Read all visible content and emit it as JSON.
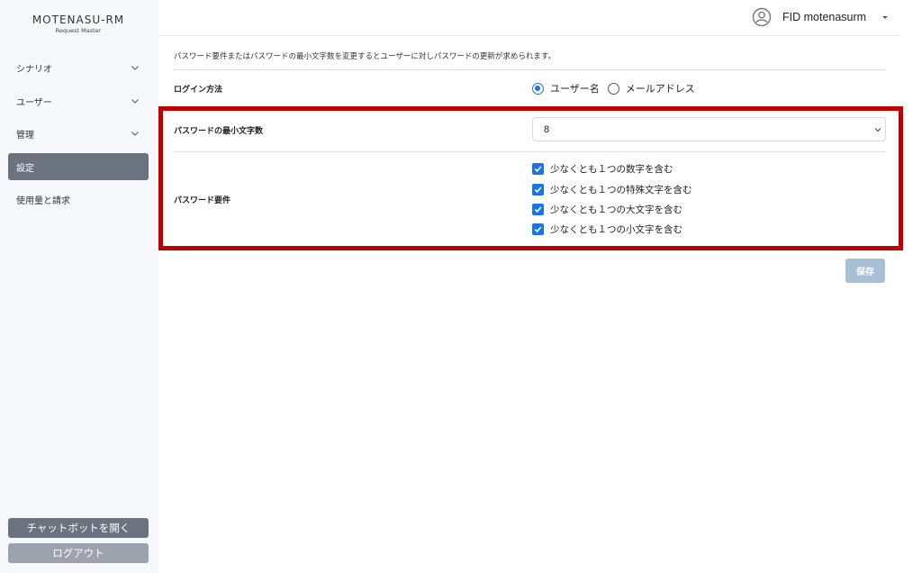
{
  "app": {
    "logo_main": "MOTENASU-RM",
    "logo_sub": "Request Master"
  },
  "sidebar": {
    "items": [
      {
        "label": "シナリオ"
      },
      {
        "label": "ユーザー"
      },
      {
        "label": "管理"
      },
      {
        "label": "設定"
      },
      {
        "label": "使用量と請求"
      }
    ],
    "chat_button": "チャットボットを開く",
    "logout_button": "ログアウト"
  },
  "header": {
    "user_name": "FID motenasurm"
  },
  "main": {
    "description": "パスワード要件またはパスワードの最小文字数を変更するとユーザーに対しパスワードの更新が求められます。",
    "login_method": {
      "label": "ログイン方法",
      "options": [
        "ユーザー名",
        "メールアドレス"
      ],
      "selected": "ユーザー名"
    },
    "min_length": {
      "label": "パスワードの最小文字数",
      "value": "8"
    },
    "requirements": {
      "label": "パスワード要件",
      "items": [
        {
          "label": "少なくとも１つの数字を含む",
          "checked": true
        },
        {
          "label": "少なくとも１つの特殊文字を含む",
          "checked": true
        },
        {
          "label": "少なくとも１つの大文字を含む",
          "checked": true
        },
        {
          "label": "少なくとも１つの小文字を含む",
          "checked": true
        }
      ]
    },
    "save_label": "保存"
  },
  "colors": {
    "accent": "#1a73e8",
    "highlight_border": "#c00000",
    "active_nav": "#6b7280",
    "save_disabled": "#a9bfd6"
  }
}
